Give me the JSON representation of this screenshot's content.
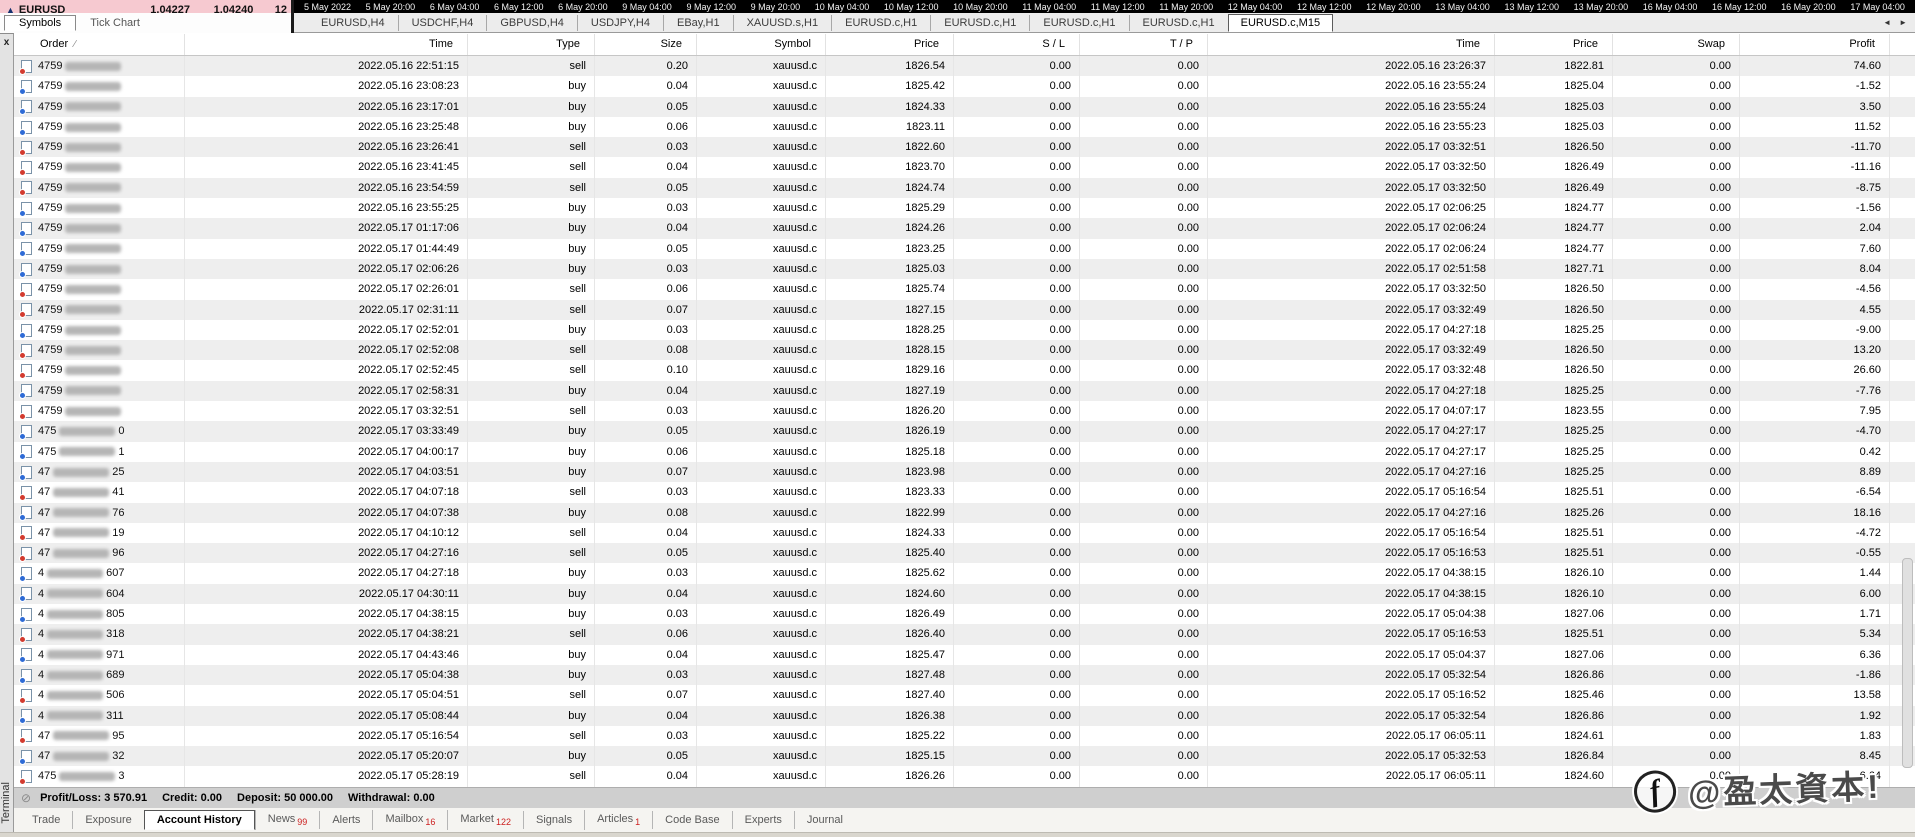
{
  "market_watch": {
    "trend_icon": "▲",
    "symbol": "EURUSD",
    "bid": "1.04227",
    "ask": "1.04240",
    "extra": "12",
    "tabs": [
      {
        "label": "Symbols",
        "active": true
      },
      {
        "label": "Tick Chart"
      }
    ]
  },
  "chart": {
    "time_axis": [
      "5 May 2022",
      "5 May 20:00",
      "6 May 04:00",
      "6 May 12:00",
      "6 May 20:00",
      "9 May 04:00",
      "9 May 12:00",
      "9 May 20:00",
      "10 May 04:00",
      "10 May 12:00",
      "10 May 20:00",
      "11 May 04:00",
      "11 May 12:00",
      "11 May 20:00",
      "12 May 04:00",
      "12 May 12:00",
      "12 May 20:00",
      "13 May 04:00",
      "13 May 12:00",
      "13 May 20:00",
      "16 May 04:00",
      "16 May 12:00",
      "16 May 20:00",
      "17 May 04:00"
    ]
  },
  "chart_tabs": [
    {
      "label": "EURUSD,H4"
    },
    {
      "label": "USDCHF,H4"
    },
    {
      "label": "GBPUSD,H4"
    },
    {
      "label": "USDJPY,H4"
    },
    {
      "label": "EBay,H1"
    },
    {
      "label": "XAUUSD.s,H1"
    },
    {
      "label": "EURUSD.c,H1"
    },
    {
      "label": "EURUSD.c,H1"
    },
    {
      "label": "EURUSD.c,H1"
    },
    {
      "label": "EURUSD.c,H1"
    },
    {
      "label": "EURUSD.c,M15",
      "active": true
    }
  ],
  "tab_scroll": {
    "left": "◄",
    "right": "►"
  },
  "terminal": {
    "close_label": "x",
    "vertical_label": "Terminal"
  },
  "history_table": {
    "sort_indicator": "∕",
    "columns": [
      {
        "label": "Order",
        "align": "left"
      },
      {
        "label": "Time"
      },
      {
        "label": "Type"
      },
      {
        "label": "Size"
      },
      {
        "label": "Symbol"
      },
      {
        "label": "Price"
      },
      {
        "label": "S / L"
      },
      {
        "label": "T / P"
      },
      {
        "label": "Time"
      },
      {
        "label": "Price"
      },
      {
        "label": "Swap"
      },
      {
        "label": "Profit"
      }
    ],
    "rows": [
      {
        "order_left": "4759",
        "order_right": "",
        "time": "2022.05.16 22:51:15",
        "type": "sell",
        "size": "0.20",
        "symbol": "xauusd.c",
        "price": "1826.54",
        "sl": "0.00",
        "tp": "0.00",
        "close_time": "2022.05.16 23:26:37",
        "close_price": "1822.81",
        "swap": "0.00",
        "profit": "74.60"
      },
      {
        "order_left": "4759",
        "order_right": "",
        "time": "2022.05.16 23:08:23",
        "type": "buy",
        "size": "0.04",
        "symbol": "xauusd.c",
        "price": "1825.42",
        "sl": "0.00",
        "tp": "0.00",
        "close_time": "2022.05.16 23:55:24",
        "close_price": "1825.04",
        "swap": "0.00",
        "profit": "-1.52"
      },
      {
        "order_left": "4759",
        "order_right": "",
        "time": "2022.05.16 23:17:01",
        "type": "buy",
        "size": "0.05",
        "symbol": "xauusd.c",
        "price": "1824.33",
        "sl": "0.00",
        "tp": "0.00",
        "close_time": "2022.05.16 23:55:24",
        "close_price": "1825.03",
        "swap": "0.00",
        "profit": "3.50"
      },
      {
        "order_left": "4759",
        "order_right": "",
        "time": "2022.05.16 23:25:48",
        "type": "buy",
        "size": "0.06",
        "symbol": "xauusd.c",
        "price": "1823.11",
        "sl": "0.00",
        "tp": "0.00",
        "close_time": "2022.05.16 23:55:23",
        "close_price": "1825.03",
        "swap": "0.00",
        "profit": "11.52"
      },
      {
        "order_left": "4759",
        "order_right": "",
        "time": "2022.05.16 23:26:41",
        "type": "sell",
        "size": "0.03",
        "symbol": "xauusd.c",
        "price": "1822.60",
        "sl": "0.00",
        "tp": "0.00",
        "close_time": "2022.05.17 03:32:51",
        "close_price": "1826.50",
        "swap": "0.00",
        "profit": "-11.70"
      },
      {
        "order_left": "4759",
        "order_right": "",
        "time": "2022.05.16 23:41:45",
        "type": "sell",
        "size": "0.04",
        "symbol": "xauusd.c",
        "price": "1823.70",
        "sl": "0.00",
        "tp": "0.00",
        "close_time": "2022.05.17 03:32:50",
        "close_price": "1826.49",
        "swap": "0.00",
        "profit": "-11.16"
      },
      {
        "order_left": "4759",
        "order_right": "",
        "time": "2022.05.16 23:54:59",
        "type": "sell",
        "size": "0.05",
        "symbol": "xauusd.c",
        "price": "1824.74",
        "sl": "0.00",
        "tp": "0.00",
        "close_time": "2022.05.17 03:32:50",
        "close_price": "1826.49",
        "swap": "0.00",
        "profit": "-8.75"
      },
      {
        "order_left": "4759",
        "order_right": "",
        "time": "2022.05.16 23:55:25",
        "type": "buy",
        "size": "0.03",
        "symbol": "xauusd.c",
        "price": "1825.29",
        "sl": "0.00",
        "tp": "0.00",
        "close_time": "2022.05.17 02:06:25",
        "close_price": "1824.77",
        "swap": "0.00",
        "profit": "-1.56"
      },
      {
        "order_left": "4759",
        "order_right": "",
        "time": "2022.05.17 01:17:06",
        "type": "buy",
        "size": "0.04",
        "symbol": "xauusd.c",
        "price": "1824.26",
        "sl": "0.00",
        "tp": "0.00",
        "close_time": "2022.05.17 02:06:24",
        "close_price": "1824.77",
        "swap": "0.00",
        "profit": "2.04"
      },
      {
        "order_left": "4759",
        "order_right": "",
        "time": "2022.05.17 01:44:49",
        "type": "buy",
        "size": "0.05",
        "symbol": "xauusd.c",
        "price": "1823.25",
        "sl": "0.00",
        "tp": "0.00",
        "close_time": "2022.05.17 02:06:24",
        "close_price": "1824.77",
        "swap": "0.00",
        "profit": "7.60"
      },
      {
        "order_left": "4759",
        "order_right": "",
        "time": "2022.05.17 02:06:26",
        "type": "buy",
        "size": "0.03",
        "symbol": "xauusd.c",
        "price": "1825.03",
        "sl": "0.00",
        "tp": "0.00",
        "close_time": "2022.05.17 02:51:58",
        "close_price": "1827.71",
        "swap": "0.00",
        "profit": "8.04"
      },
      {
        "order_left": "4759",
        "order_right": "",
        "time": "2022.05.17 02:26:01",
        "type": "sell",
        "size": "0.06",
        "symbol": "xauusd.c",
        "price": "1825.74",
        "sl": "0.00",
        "tp": "0.00",
        "close_time": "2022.05.17 03:32:50",
        "close_price": "1826.50",
        "swap": "0.00",
        "profit": "-4.56"
      },
      {
        "order_left": "4759",
        "order_right": "",
        "time": "2022.05.17 02:31:11",
        "type": "sell",
        "size": "0.07",
        "symbol": "xauusd.c",
        "price": "1827.15",
        "sl": "0.00",
        "tp": "0.00",
        "close_time": "2022.05.17 03:32:49",
        "close_price": "1826.50",
        "swap": "0.00",
        "profit": "4.55"
      },
      {
        "order_left": "4759",
        "order_right": "",
        "time": "2022.05.17 02:52:01",
        "type": "buy",
        "size": "0.03",
        "symbol": "xauusd.c",
        "price": "1828.25",
        "sl": "0.00",
        "tp": "0.00",
        "close_time": "2022.05.17 04:27:18",
        "close_price": "1825.25",
        "swap": "0.00",
        "profit": "-9.00"
      },
      {
        "order_left": "4759",
        "order_right": "",
        "time": "2022.05.17 02:52:08",
        "type": "sell",
        "size": "0.08",
        "symbol": "xauusd.c",
        "price": "1828.15",
        "sl": "0.00",
        "tp": "0.00",
        "close_time": "2022.05.17 03:32:49",
        "close_price": "1826.50",
        "swap": "0.00",
        "profit": "13.20"
      },
      {
        "order_left": "4759",
        "order_right": "",
        "time": "2022.05.17 02:52:45",
        "type": "sell",
        "size": "0.10",
        "symbol": "xauusd.c",
        "price": "1829.16",
        "sl": "0.00",
        "tp": "0.00",
        "close_time": "2022.05.17 03:32:48",
        "close_price": "1826.50",
        "swap": "0.00",
        "profit": "26.60"
      },
      {
        "order_left": "4759",
        "order_right": "",
        "time": "2022.05.17 02:58:31",
        "type": "buy",
        "size": "0.04",
        "symbol": "xauusd.c",
        "price": "1827.19",
        "sl": "0.00",
        "tp": "0.00",
        "close_time": "2022.05.17 04:27:18",
        "close_price": "1825.25",
        "swap": "0.00",
        "profit": "-7.76"
      },
      {
        "order_left": "4759",
        "order_right": "",
        "time": "2022.05.17 03:32:51",
        "type": "sell",
        "size": "0.03",
        "symbol": "xauusd.c",
        "price": "1826.20",
        "sl": "0.00",
        "tp": "0.00",
        "close_time": "2022.05.17 04:07:17",
        "close_price": "1823.55",
        "swap": "0.00",
        "profit": "7.95"
      },
      {
        "order_left": "475",
        "order_right": "0",
        "time": "2022.05.17 03:33:49",
        "type": "buy",
        "size": "0.05",
        "symbol": "xauusd.c",
        "price": "1826.19",
        "sl": "0.00",
        "tp": "0.00",
        "close_time": "2022.05.17 04:27:17",
        "close_price": "1825.25",
        "swap": "0.00",
        "profit": "-4.70"
      },
      {
        "order_left": "475",
        "order_right": "1",
        "time": "2022.05.17 04:00:17",
        "type": "buy",
        "size": "0.06",
        "symbol": "xauusd.c",
        "price": "1825.18",
        "sl": "0.00",
        "tp": "0.00",
        "close_time": "2022.05.17 04:27:17",
        "close_price": "1825.25",
        "swap": "0.00",
        "profit": "0.42"
      },
      {
        "order_left": "47",
        "order_right": "25",
        "time": "2022.05.17 04:03:51",
        "type": "buy",
        "size": "0.07",
        "symbol": "xauusd.c",
        "price": "1823.98",
        "sl": "0.00",
        "tp": "0.00",
        "close_time": "2022.05.17 04:27:16",
        "close_price": "1825.25",
        "swap": "0.00",
        "profit": "8.89"
      },
      {
        "order_left": "47",
        "order_right": "41",
        "time": "2022.05.17 04:07:18",
        "type": "sell",
        "size": "0.03",
        "symbol": "xauusd.c",
        "price": "1823.33",
        "sl": "0.00",
        "tp": "0.00",
        "close_time": "2022.05.17 05:16:54",
        "close_price": "1825.51",
        "swap": "0.00",
        "profit": "-6.54"
      },
      {
        "order_left": "47",
        "order_right": "76",
        "time": "2022.05.17 04:07:38",
        "type": "buy",
        "size": "0.08",
        "symbol": "xauusd.c",
        "price": "1822.99",
        "sl": "0.00",
        "tp": "0.00",
        "close_time": "2022.05.17 04:27:16",
        "close_price": "1825.26",
        "swap": "0.00",
        "profit": "18.16"
      },
      {
        "order_left": "47",
        "order_right": "19",
        "time": "2022.05.17 04:10:12",
        "type": "sell",
        "size": "0.04",
        "symbol": "xauusd.c",
        "price": "1824.33",
        "sl": "0.00",
        "tp": "0.00",
        "close_time": "2022.05.17 05:16:54",
        "close_price": "1825.51",
        "swap": "0.00",
        "profit": "-4.72"
      },
      {
        "order_left": "47",
        "order_right": "96",
        "time": "2022.05.17 04:27:16",
        "type": "sell",
        "size": "0.05",
        "symbol": "xauusd.c",
        "price": "1825.40",
        "sl": "0.00",
        "tp": "0.00",
        "close_time": "2022.05.17 05:16:53",
        "close_price": "1825.51",
        "swap": "0.00",
        "profit": "-0.55"
      },
      {
        "order_left": "4",
        "order_right": "607",
        "time": "2022.05.17 04:27:18",
        "type": "buy",
        "size": "0.03",
        "symbol": "xauusd.c",
        "price": "1825.62",
        "sl": "0.00",
        "tp": "0.00",
        "close_time": "2022.05.17 04:38:15",
        "close_price": "1826.10",
        "swap": "0.00",
        "profit": "1.44"
      },
      {
        "order_left": "4",
        "order_right": "604",
        "time": "2022.05.17 04:30:11",
        "type": "buy",
        "size": "0.04",
        "symbol": "xauusd.c",
        "price": "1824.60",
        "sl": "0.00",
        "tp": "0.00",
        "close_time": "2022.05.17 04:38:15",
        "close_price": "1826.10",
        "swap": "0.00",
        "profit": "6.00"
      },
      {
        "order_left": "4",
        "order_right": "805",
        "time": "2022.05.17 04:38:15",
        "type": "buy",
        "size": "0.03",
        "symbol": "xauusd.c",
        "price": "1826.49",
        "sl": "0.00",
        "tp": "0.00",
        "close_time": "2022.05.17 05:04:38",
        "close_price": "1827.06",
        "swap": "0.00",
        "profit": "1.71"
      },
      {
        "order_left": "4",
        "order_right": "318",
        "time": "2022.05.17 04:38:21",
        "type": "sell",
        "size": "0.06",
        "symbol": "xauusd.c",
        "price": "1826.40",
        "sl": "0.00",
        "tp": "0.00",
        "close_time": "2022.05.17 05:16:53",
        "close_price": "1825.51",
        "swap": "0.00",
        "profit": "5.34"
      },
      {
        "order_left": "4",
        "order_right": "971",
        "time": "2022.05.17 04:43:46",
        "type": "buy",
        "size": "0.04",
        "symbol": "xauusd.c",
        "price": "1825.47",
        "sl": "0.00",
        "tp": "0.00",
        "close_time": "2022.05.17 05:04:37",
        "close_price": "1827.06",
        "swap": "0.00",
        "profit": "6.36"
      },
      {
        "order_left": "4",
        "order_right": "689",
        "time": "2022.05.17 05:04:38",
        "type": "buy",
        "size": "0.03",
        "symbol": "xauusd.c",
        "price": "1827.48",
        "sl": "0.00",
        "tp": "0.00",
        "close_time": "2022.05.17 05:32:54",
        "close_price": "1826.86",
        "swap": "0.00",
        "profit": "-1.86"
      },
      {
        "order_left": "4",
        "order_right": "506",
        "time": "2022.05.17 05:04:51",
        "type": "sell",
        "size": "0.07",
        "symbol": "xauusd.c",
        "price": "1827.40",
        "sl": "0.00",
        "tp": "0.00",
        "close_time": "2022.05.17 05:16:52",
        "close_price": "1825.46",
        "swap": "0.00",
        "profit": "13.58"
      },
      {
        "order_left": "4",
        "order_right": "311",
        "time": "2022.05.17 05:08:44",
        "type": "buy",
        "size": "0.04",
        "symbol": "xauusd.c",
        "price": "1826.38",
        "sl": "0.00",
        "tp": "0.00",
        "close_time": "2022.05.17 05:32:54",
        "close_price": "1826.86",
        "swap": "0.00",
        "profit": "1.92"
      },
      {
        "order_left": "47",
        "order_right": "95",
        "time": "2022.05.17 05:16:54",
        "type": "sell",
        "size": "0.03",
        "symbol": "xauusd.c",
        "price": "1825.22",
        "sl": "0.00",
        "tp": "0.00",
        "close_time": "2022.05.17 06:05:11",
        "close_price": "1824.61",
        "swap": "0.00",
        "profit": "1.83"
      },
      {
        "order_left": "47",
        "order_right": "32",
        "time": "2022.05.17 05:20:07",
        "type": "buy",
        "size": "0.05",
        "symbol": "xauusd.c",
        "price": "1825.15",
        "sl": "0.00",
        "tp": "0.00",
        "close_time": "2022.05.17 05:32:53",
        "close_price": "1826.84",
        "swap": "0.00",
        "profit": "8.45"
      },
      {
        "order_left": "475",
        "order_right": "3",
        "time": "2022.05.17 05:28:19",
        "type": "sell",
        "size": "0.04",
        "symbol": "xauusd.c",
        "price": "1826.26",
        "sl": "0.00",
        "tp": "0.00",
        "close_time": "2022.05.17 06:05:11",
        "close_price": "1824.60",
        "swap": "0.00",
        "profit": "6.64"
      }
    ]
  },
  "status_bar": {
    "icon": "⊘",
    "items": [
      {
        "label": "Profit/Loss:",
        "value": "3 570.91"
      },
      {
        "label": "Credit:",
        "value": "0.00"
      },
      {
        "label": "Deposit:",
        "value": "50 000.00"
      },
      {
        "label": "Withdrawal:",
        "value": "0.00"
      }
    ]
  },
  "bottom_tabs": [
    {
      "label": "Trade"
    },
    {
      "label": "Exposure"
    },
    {
      "label": "Account History",
      "active": true
    },
    {
      "label": "News",
      "badge": "99"
    },
    {
      "label": "Alerts"
    },
    {
      "label": "Mailbox",
      "badge": "16"
    },
    {
      "label": "Market",
      "badge": "122"
    },
    {
      "label": "Signals"
    },
    {
      "label": "Articles",
      "badge": "1"
    },
    {
      "label": "Code Base"
    },
    {
      "label": "Experts"
    },
    {
      "label": "Journal"
    }
  ],
  "watermark": {
    "icon_letter": "f",
    "text": "@盈太資本",
    "suffix": "!"
  }
}
